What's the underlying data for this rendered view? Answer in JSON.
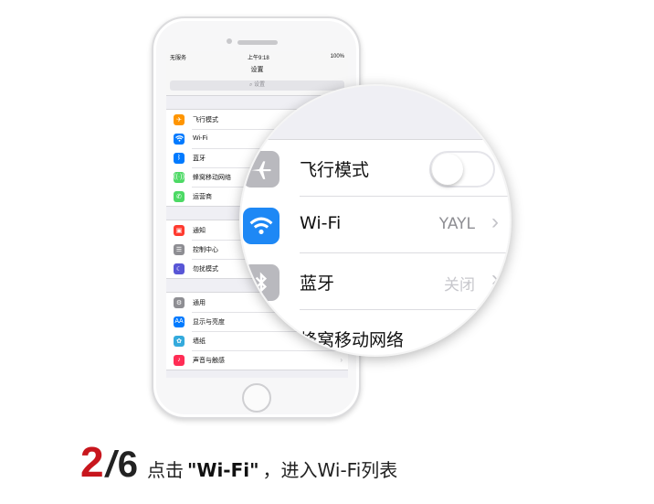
{
  "status_bar": {
    "carrier": "无服务",
    "time": "上午9:18",
    "battery": "100%"
  },
  "settings": {
    "title": "设置",
    "search_placeholder": "设置",
    "group1": [
      {
        "label": "飞行模式",
        "icon": "airplane-icon",
        "color": "#ff9500"
      },
      {
        "label": "Wi-Fi",
        "icon": "wifi-icon",
        "color": "#007aff"
      },
      {
        "label": "蓝牙",
        "icon": "bluetooth-icon",
        "color": "#007aff"
      },
      {
        "label": "蜂窝移动网络",
        "icon": "cellular-icon",
        "color": "#4cd964"
      },
      {
        "label": "运营商",
        "icon": "phone-icon",
        "color": "#4cd964"
      }
    ],
    "group2": [
      {
        "label": "通知",
        "icon": "notifications-icon",
        "color": "#ff3b30"
      },
      {
        "label": "控制中心",
        "icon": "control-center-icon",
        "color": "#8e8e93"
      },
      {
        "label": "勿扰模式",
        "icon": "moon-icon",
        "color": "#5856d6"
      }
    ],
    "group3": [
      {
        "label": "通用",
        "icon": "gear-icon",
        "color": "#8e8e93"
      },
      {
        "label": "显示与亮度",
        "icon": "display-icon",
        "color": "#007aff"
      },
      {
        "label": "墙纸",
        "icon": "wallpaper-icon",
        "color": "#34aadc"
      },
      {
        "label": "声音与触感",
        "icon": "sound-icon",
        "color": "#ff2d55"
      }
    ]
  },
  "magnifier": {
    "airplane_label": "飞行模式",
    "wifi_label": "Wi-Fi",
    "wifi_value": "YAYL",
    "bluetooth_label": "蓝牙",
    "bluetooth_value": "关闭",
    "cellular_label": "蜂窝移动网络"
  },
  "caption": {
    "step_current": "2",
    "step_separator": "/",
    "step_total": "6",
    "text_before": "点击",
    "quoted": "\"Wi-Fi\"",
    "text_after": "，进入Wi-Fi列表"
  }
}
